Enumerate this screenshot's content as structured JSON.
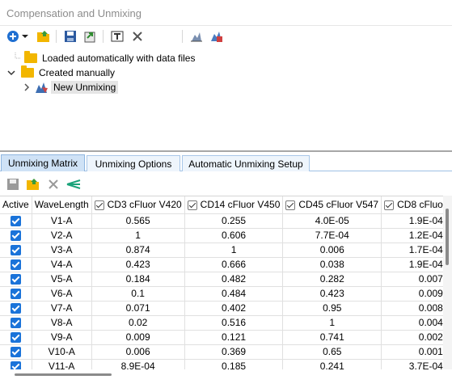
{
  "window": {
    "title": "Compensation and Unmixing"
  },
  "toolbar": {
    "buttons": [
      "add-icon",
      "dropdown-arrow-icon",
      "open-folder-icon",
      "save-icon",
      "export-icon",
      "rename-icon",
      "delete-icon",
      "unmix-icon",
      "apply-unmix-icon"
    ]
  },
  "tree": {
    "items": [
      {
        "label": "Loaded automatically with data files",
        "icon": "folder-icon"
      },
      {
        "label": "Created manually",
        "icon": "folder-icon",
        "expanded": true
      },
      {
        "label": "New Unmixing",
        "icon": "unmixing-icon",
        "selected": true
      }
    ]
  },
  "tabs": [
    {
      "label": "Unmixing Matrix",
      "active": true
    },
    {
      "label": "Unmixing Options",
      "active": false
    },
    {
      "label": "Automatic Unmixing Setup",
      "active": false
    }
  ],
  "grid": {
    "headers": [
      "Active",
      "WaveLength",
      "CD3 cFluor V420",
      "CD14 cFluor V450",
      "CD45 cFluor V547",
      "CD8 cFluo"
    ],
    "rows": [
      {
        "active": true,
        "wl": "V1-A",
        "c1": "0.565",
        "c2": "0.255",
        "c3": "4.0E-05",
        "c4": "1.9E-04"
      },
      {
        "active": true,
        "wl": "V2-A",
        "c1": "1",
        "c2": "0.606",
        "c3": "7.7E-04",
        "c4": "1.2E-04"
      },
      {
        "active": true,
        "wl": "V3-A",
        "c1": "0.874",
        "c2": "1",
        "c3": "0.006",
        "c4": "1.7E-04"
      },
      {
        "active": true,
        "wl": "V4-A",
        "c1": "0.423",
        "c2": "0.666",
        "c3": "0.038",
        "c4": "1.9E-04"
      },
      {
        "active": true,
        "wl": "V5-A",
        "c1": "0.184",
        "c2": "0.482",
        "c3": "0.282",
        "c4": "0.007"
      },
      {
        "active": true,
        "wl": "V6-A",
        "c1": "0.1",
        "c2": "0.484",
        "c3": "0.423",
        "c4": "0.009"
      },
      {
        "active": true,
        "wl": "V7-A",
        "c1": "0.071",
        "c2": "0.402",
        "c3": "0.95",
        "c4": "0.008"
      },
      {
        "active": true,
        "wl": "V8-A",
        "c1": "0.02",
        "c2": "0.516",
        "c3": "1",
        "c4": "0.004"
      },
      {
        "active": true,
        "wl": "V9-A",
        "c1": "0.009",
        "c2": "0.121",
        "c3": "0.741",
        "c4": "0.002"
      },
      {
        "active": true,
        "wl": "V10-A",
        "c1": "0.006",
        "c2": "0.369",
        "c3": "0.65",
        "c4": "0.001"
      },
      {
        "active": true,
        "wl": "V11-A",
        "c1": "8.9E-04",
        "c2": "0.185",
        "c3": "0.241",
        "c4": "3.7E-04"
      }
    ]
  },
  "colors": {
    "accent": "#1a73d9",
    "tabActive": "#cfe2f6",
    "folder": "#f2b600"
  }
}
